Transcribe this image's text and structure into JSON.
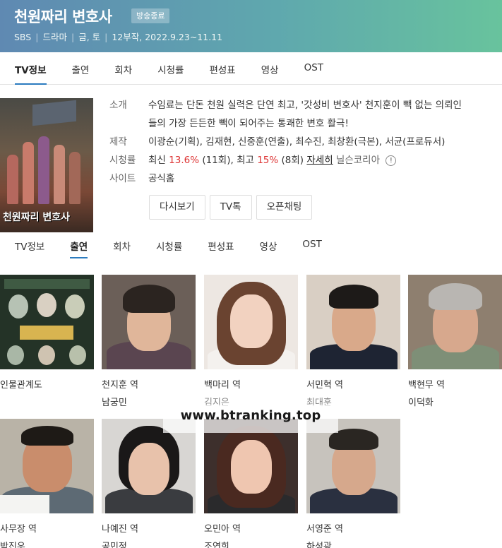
{
  "header": {
    "title": "천원짜리 변호사",
    "badge": "방송종료",
    "meta": [
      "SBS",
      "드라마",
      "금, 토",
      "12부작, 2022.9.23~11.11"
    ]
  },
  "top_tabs": [
    "TV정보",
    "출연",
    "회차",
    "시청률",
    "편성표",
    "영상",
    "OST"
  ],
  "poster": {
    "title": "천원짜리 변호사"
  },
  "info": {
    "intro_label": "소개",
    "intro_text": "수임료는 단돈 천원 실력은 단연 최고, '갓성비 변호사' 천지훈이 빽 없는 의뢰인들의 가장 든든한 빽이 되어주는 통쾌한 변호 활극!",
    "production_label": "제작",
    "production_text": "이광순(기획), 김재현, 신중훈(연출), 최수진, 최창환(극본), 서균(프로듀서)",
    "rating_label": "시청률",
    "rating_latest_label": "최신",
    "rating_latest_value": "13.6%",
    "rating_latest_ep": "(11회),",
    "rating_max_label": "최고",
    "rating_max_value": "15%",
    "rating_max_ep": "(8회)",
    "rating_detail_link": "자세히",
    "rating_source": "닐슨코리아",
    "site_label": "사이트",
    "site_text": "공식홈"
  },
  "buttons": [
    "다시보기",
    "TV톡",
    "오픈채팅"
  ],
  "sub_tabs": [
    "TV정보",
    "출연",
    "회차",
    "시청률",
    "편성표",
    "영상",
    "OST"
  ],
  "cast": [
    {
      "role": "인물관계도",
      "actor": ""
    },
    {
      "role": "천지훈 역",
      "actor": "남궁민"
    },
    {
      "role": "백마리 역",
      "actor": "김지은"
    },
    {
      "role": "서민혁 역",
      "actor": "최대훈"
    },
    {
      "role": "백현무 역",
      "actor": "이덕화"
    },
    {
      "role": "사무장 역",
      "actor": "박진우"
    },
    {
      "role": "나예진 역",
      "actor": "공민정"
    },
    {
      "role": "오민아 역",
      "actor": "조연희"
    },
    {
      "role": "서영준 역",
      "actor": "하성광"
    }
  ],
  "watermark": "www.btranking.top",
  "colors": {
    "accent": "#2b7bbf",
    "rating_red": "#dd3333"
  }
}
